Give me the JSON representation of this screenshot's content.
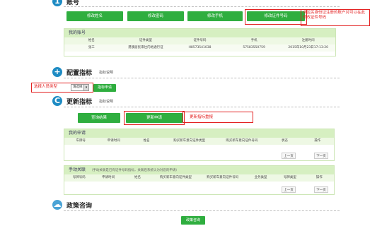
{
  "account": {
    "title": "账号",
    "buttons": [
      "修改姓名",
      "修改密码",
      "修改手机",
      "修改证件号码"
    ],
    "annotation": "非区民身份证注册的账户对可以在此修改证件号码",
    "panel_title": "我的账号",
    "columns": [
      "姓名",
      "证件类型",
      "证件号码",
      "手机",
      "注册时间"
    ],
    "row": [
      "张三",
      "港澳居民来往内地通行证",
      "H8573541038",
      "57583550759",
      "2015年10月23日17:13:20"
    ]
  },
  "config": {
    "title": "配置指标",
    "link": "指标说明",
    "annotation": "选择人员类型",
    "select_value": "请选择",
    "button": "指标申请"
  },
  "update": {
    "title": "更新指标",
    "link": "指标说明",
    "buttons": [
      "查询结果",
      "更新申请"
    ],
    "annotation": "更新指标重报",
    "my_panel_title": "我的申请",
    "my_columns": [
      "车牌号",
      "申请时间",
      "姓名",
      "购买新车意向证件类型",
      "购买新车意向证件号码",
      "状态",
      "操作"
    ],
    "pager": [
      "上一页",
      "下一页"
    ],
    "manual_panel_title": "手动关联",
    "manual_note": "（手动关联是已有证件号码指标，关联后系统认为对您的申请）",
    "manual_columns": [
      "号牌号码",
      "申请时间",
      "姓名",
      "购买新车意向证件类型",
      "购买新车意向证件号码",
      "业务类型",
      "号牌类型",
      "操作"
    ]
  },
  "policy": {
    "title": "政策咨询",
    "button": "政策咨询"
  }
}
